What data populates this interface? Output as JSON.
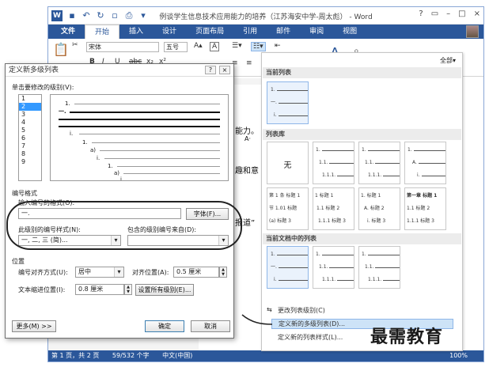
{
  "window": {
    "title": "例谈学生信息技术应用能力的培养（江苏海安中学-周太彪） - Word",
    "controls": [
      "?",
      "▭",
      "–",
      "□",
      "×"
    ]
  },
  "ribbon": {
    "tabs": [
      "文件",
      "开始",
      "插入",
      "设计",
      "页面布局",
      "引用",
      "邮件",
      "审阅",
      "视图"
    ],
    "active_tab": "开始",
    "font_name": "宋体",
    "font_size": "五号",
    "format_buttons": [
      "B",
      "I",
      "U",
      "abc",
      "x₂",
      "x²"
    ]
  },
  "document": {
    "snippets": [
      "能力。",
      "A·",
      "趣和意",
      "报道”"
    ]
  },
  "status": {
    "page": "第 1 页，共 2 页",
    "words": "59/532 个字",
    "lang": "中文(中国)",
    "zoom": "100%"
  },
  "panel": {
    "all_label": "全部▾",
    "section_current": "当前列表",
    "section_library": "列表库",
    "section_in_doc": "当前文档中的列表",
    "none_label": "无",
    "cmd_change_level": "更改列表级别(C)",
    "cmd_define_multilevel": "定义新的多级列表(D)...",
    "cmd_define_style": "定义新的列表样式(L)...",
    "thumbs": {
      "current": [
        "1.",
        "一.",
        "i."
      ],
      "lib2": [
        "1.",
        "1.1.",
        "1.1.1."
      ],
      "lib3": [
        "1.",
        "1.1.",
        "1.1.1."
      ],
      "lib4": [
        "1.",
        "A.",
        "i."
      ],
      "lib5": [
        "第 1 条 标题 1",
        "节 1.01 标题",
        "(a) 标题 3"
      ],
      "lib6": [
        "1 标题 1",
        "1.1 标题 2",
        "1.1.1 标题 3"
      ],
      "lib7": [
        "1. 标题 1",
        "A. 标题 2",
        "i. 标题 3"
      ],
      "lib8": [
        "第一章 标题 1",
        "1.1 标题 2",
        "1.1.1 标题 3"
      ],
      "doc1": [
        "1.",
        "一.",
        "i."
      ],
      "doc2": [
        "1.",
        "1.1.",
        "1.1.1."
      ],
      "doc3": [
        "1.",
        "1.1.",
        "1.1.1."
      ]
    }
  },
  "dialog": {
    "title": "定义新多级列表",
    "help": "?",
    "close": "×",
    "level_label": "单击要修改的级别(V):",
    "levels": [
      "1",
      "2",
      "3",
      "4",
      "5",
      "6",
      "7",
      "8",
      "9"
    ],
    "preview_numbers": [
      "1.",
      "一.",
      "i.",
      "1.",
      "a)",
      "i.",
      "1.",
      "a)",
      "i."
    ],
    "numbering_format": "编号格式",
    "enter_format_label": "输入编号的格式(O):",
    "enter_format_value": "一.",
    "font_button": "字体(F)...",
    "style_label": "此级别的编号样式(N):",
    "style_value": "一, 二, 三 (简)...",
    "include_label": "包含的级别编号来自(D):",
    "position_title": "位置",
    "align_label": "编号对齐方式(U):",
    "align_value": "居中",
    "align_at_label": "对齐位置(A):",
    "align_at_value": "0.5 厘米",
    "indent_label": "文本缩进位置(I):",
    "indent_value": "0.8 厘米",
    "set_all_button": "设置所有级别(E)...",
    "more_button": "更多(M) >>",
    "ok_button": "确定",
    "cancel_button": "取消"
  },
  "watermark": "最需教育"
}
